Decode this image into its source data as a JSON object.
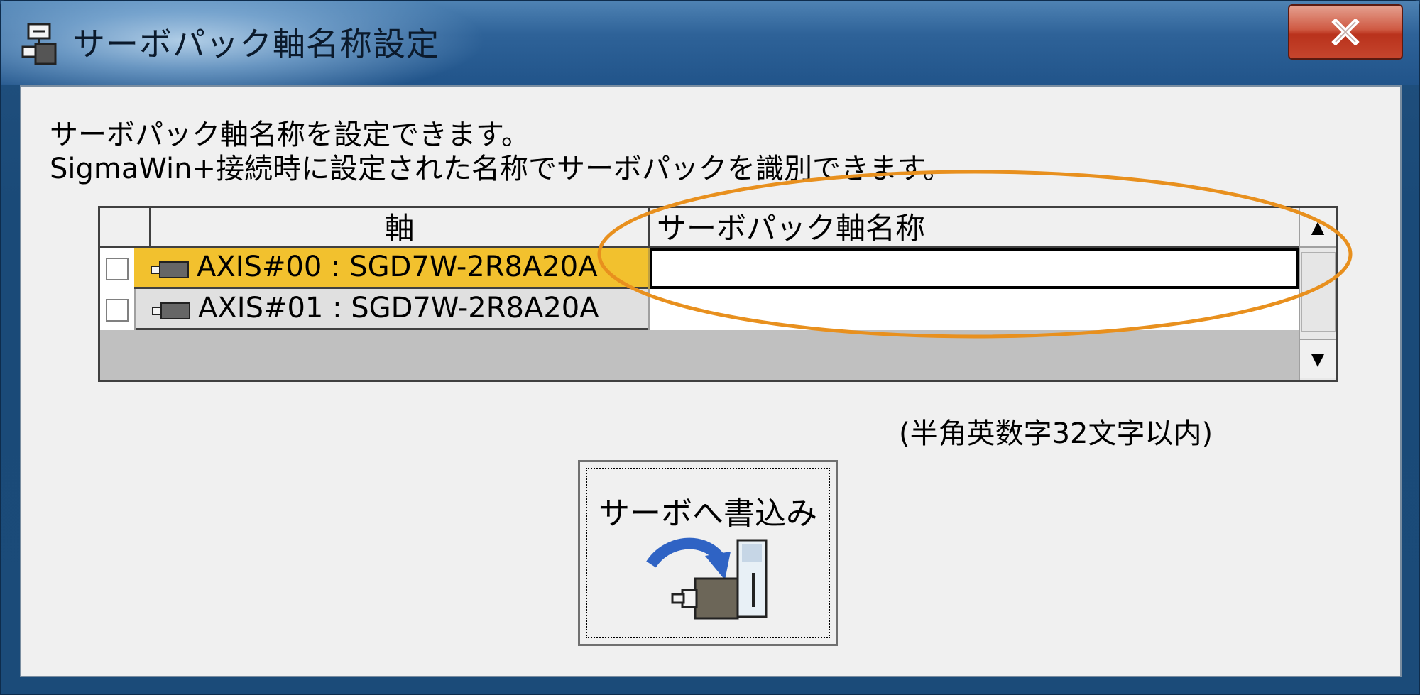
{
  "window": {
    "title": "サーボパック軸名称設定",
    "close_label": "X"
  },
  "description": {
    "line1": "サーボパック軸名称を設定できます。",
    "line2": "SigmaWin+接続時に設定された名称でサーボパックを識別できます。"
  },
  "grid": {
    "columns": [
      "",
      "軸",
      "サーボパック軸名称"
    ],
    "rows": [
      {
        "checked": false,
        "axis": "AXIS#00 : SGD7W-2R8A20A",
        "name": "",
        "selected": true
      },
      {
        "checked": false,
        "axis": "AXIS#01 : SGD7W-2R8A20A",
        "name": "",
        "selected": false
      }
    ],
    "scroll_up": "▲",
    "scroll_down": "▼"
  },
  "note": "(半角英数字32文字以内)",
  "write_button": {
    "label": "サーボへ書込み"
  },
  "colors": {
    "selected_row": "#f2c12e",
    "annotation": "#e8901e",
    "title_bar": "#21548a"
  }
}
